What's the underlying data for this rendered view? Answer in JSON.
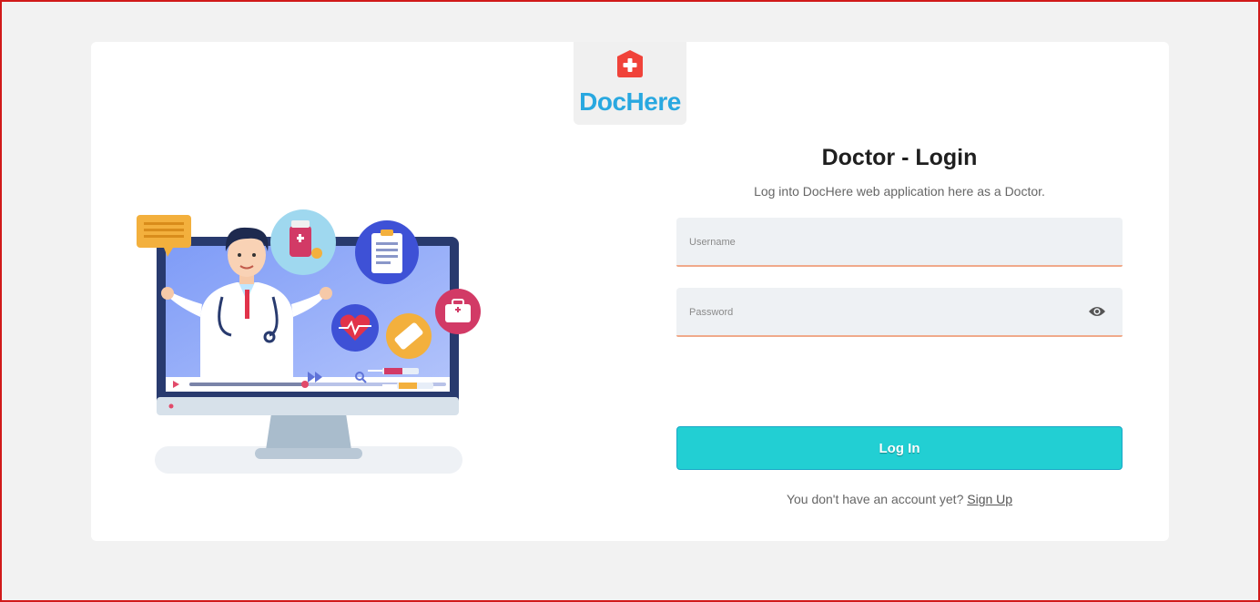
{
  "brand": {
    "name": "DocHere",
    "logo_icon": "medical-cross-icon",
    "accent_color": "#29a8e0",
    "icon_color": "#f0433a"
  },
  "illustration": {
    "name": "telemedicine-doctor-illustration"
  },
  "login": {
    "title": "Doctor - Login",
    "subtitle": "Log into DocHere web application here as a Doctor.",
    "username_placeholder": "Username",
    "password_placeholder": "Password",
    "password_toggle_icon": "eye-icon",
    "submit_label": "Log In",
    "button_color": "#22cfd3",
    "signup_prompt": "You don't have an account yet?",
    "signup_link": "Sign Up"
  }
}
